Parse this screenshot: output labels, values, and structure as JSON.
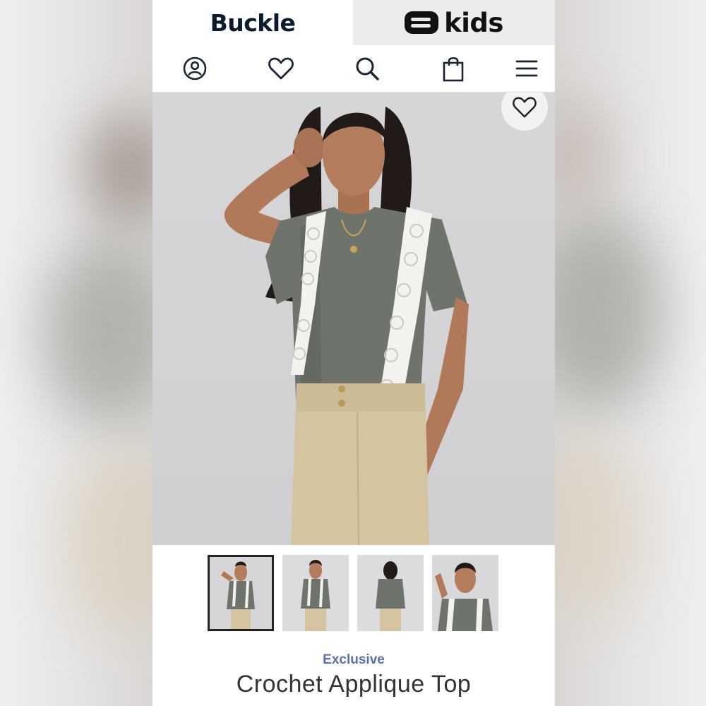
{
  "brands": {
    "buckle": "Buckle",
    "kids": "kids",
    "kids_logo_icon": "buckle-b-logo-icon"
  },
  "nav_icons": [
    "account-icon",
    "heart-icon",
    "search-icon",
    "shopping-bag-icon",
    "menu-icon"
  ],
  "product": {
    "tagline": "Exclusive",
    "title": "Crochet Applique Top",
    "favorite_icon": "heart-outline-icon",
    "thumbnails": [
      {
        "view": "front-pose",
        "selected": true
      },
      {
        "view": "front",
        "selected": false
      },
      {
        "view": "back",
        "selected": false
      },
      {
        "view": "detail",
        "selected": false
      }
    ]
  },
  "colors": {
    "tagline": "#5b6fb0",
    "brand_text": "#0b1a2d",
    "shirt": "#6e746c",
    "pants": "#d4c4a0",
    "lace": "#f2f2ee"
  }
}
